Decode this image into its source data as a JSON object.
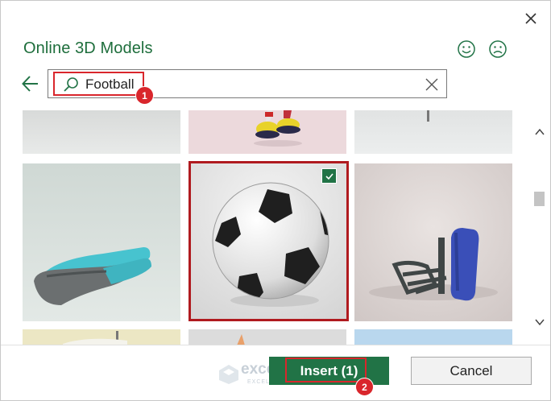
{
  "dialog": {
    "title": "Online 3D Models",
    "icons": {
      "close": "close-icon",
      "smile": "smile-feedback-icon",
      "frown": "frown-feedback-icon",
      "back": "back-arrow-icon"
    }
  },
  "search": {
    "value": "Football",
    "search_icon": "search-icon",
    "clear_icon": "clear-icon"
  },
  "annotations": {
    "step1": "1",
    "step2": "2"
  },
  "results": {
    "selected_tile": "soccer-ball",
    "tiles": [
      {
        "name": "partial-tile-1"
      },
      {
        "name": "cartoon-character-shoes"
      },
      {
        "name": "partial-tile-3"
      },
      {
        "name": "mouthguard"
      },
      {
        "name": "soccer-ball"
      },
      {
        "name": "blue-tackling-dummy"
      },
      {
        "name": "partial-tile-7"
      },
      {
        "name": "partial-tile-8"
      },
      {
        "name": "partial-tile-9"
      }
    ]
  },
  "footer": {
    "insert_label": "Insert (1)",
    "cancel_label": "Cancel"
  },
  "watermark": {
    "brand": "exceldemy",
    "tagline": "EXCEL · DATA · BI"
  },
  "colors": {
    "accent": "#217346",
    "title": "#1e6e3c",
    "highlight": "#d9262c"
  }
}
